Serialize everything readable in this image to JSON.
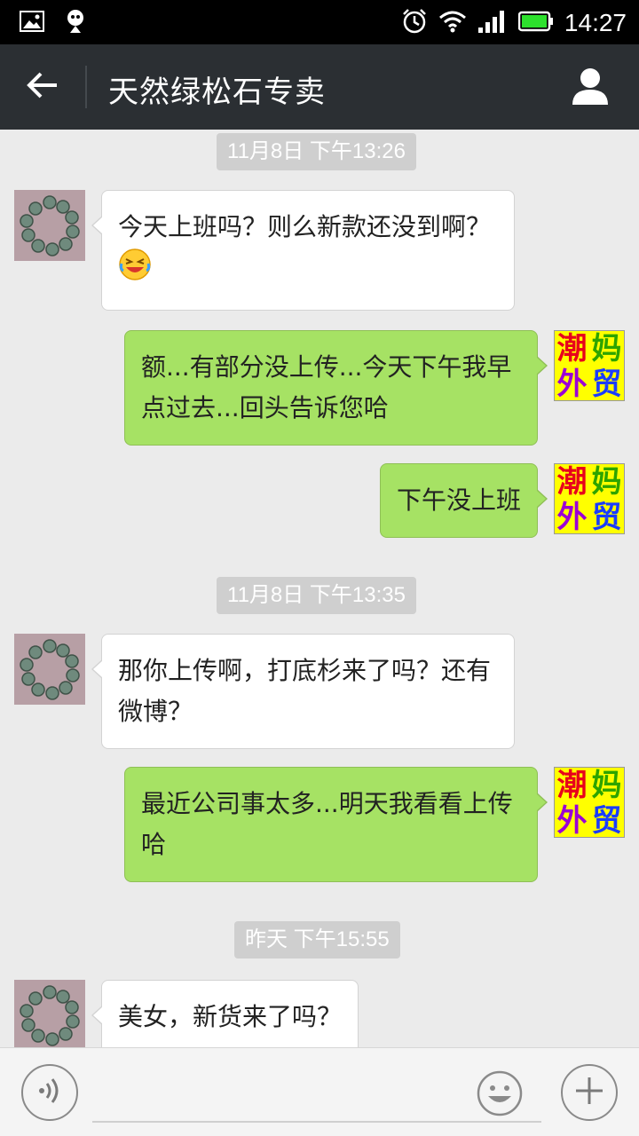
{
  "status_bar": {
    "time": "14:27",
    "icons": [
      "gallery-icon",
      "notification-icon",
      "alarm-icon",
      "wifi-icon",
      "signal-icon",
      "battery-icon"
    ]
  },
  "header": {
    "title": "天然绿松石专卖",
    "back_icon": "arrow-left-icon",
    "profile_icon": "person-icon",
    "background": "#2b2f33"
  },
  "colors": {
    "chat_background": "#ebebeb",
    "outgoing_bubble": "#a6e264",
    "incoming_bubble": "#ffffff",
    "timestamp_background": "#cfcfcf"
  },
  "outgoing_avatar": {
    "chars": [
      "潮",
      "妈",
      "外",
      "贸"
    ],
    "colors": [
      "#e8001c",
      "#2da400",
      "#9b00d6",
      "#1a3cff"
    ]
  },
  "messages": {
    "ts1": "11月8日 下午13:26",
    "m1": "今天上班吗？则么新款还没到啊？",
    "m2": "额...有部分没上传...今天下午我早点过去...回头告诉您哈",
    "m3": "下午没上班",
    "ts2": "11月8日 下午13:35",
    "m4": "那你上传啊，打底杉来了吗？还有微博？",
    "m5": "最近公司事太多...明天我看看上传哈",
    "ts3": "昨天 下午15:55",
    "m6": "美女，新货来了吗？"
  },
  "input_bar": {
    "voice_icon": "voice-icon",
    "emoji_icon": "smiley-icon",
    "more_icon": "plus-icon",
    "placeholder": ""
  }
}
